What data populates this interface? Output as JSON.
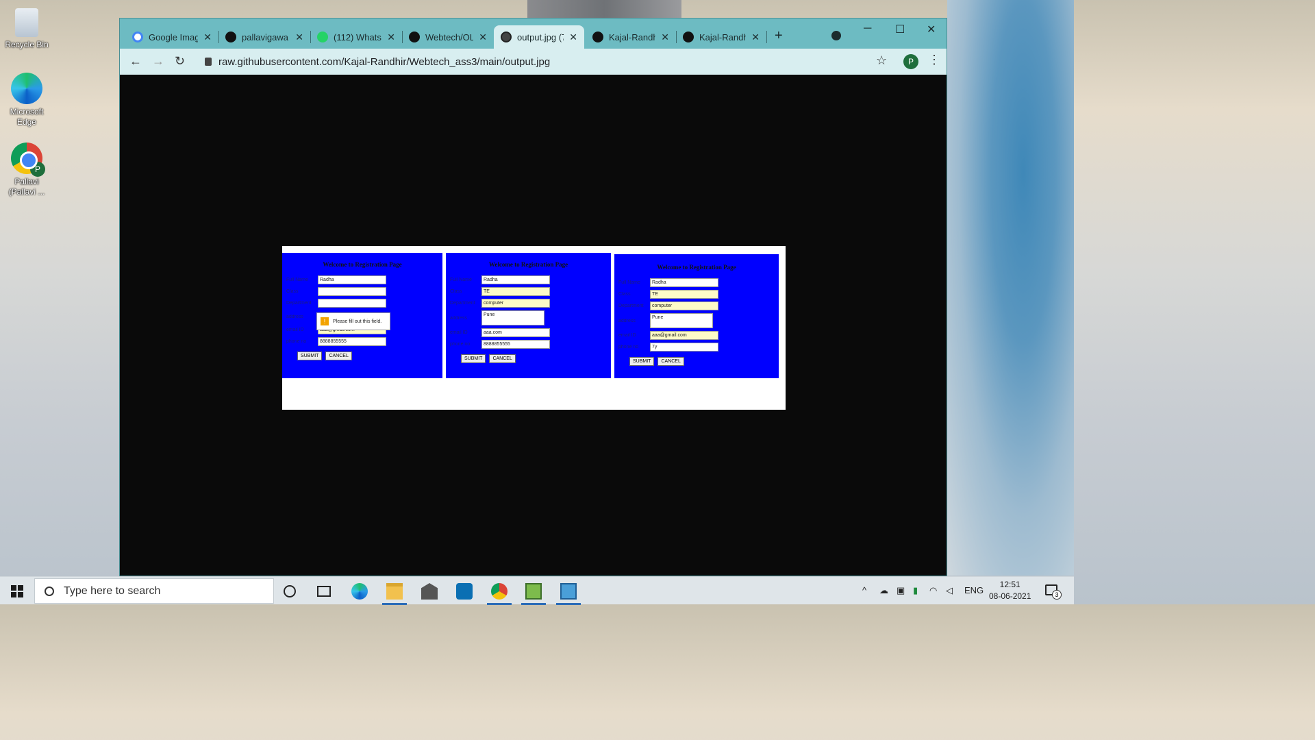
{
  "desktop": {
    "icons": [
      {
        "label": "Recycle Bin"
      },
      {
        "label": "Microsoft Edge"
      },
      {
        "label": "Pallavi (Pallavi ...",
        "badge": "P"
      }
    ]
  },
  "browser": {
    "tabs": [
      {
        "title": "Google Imag",
        "icon": "google-icon"
      },
      {
        "title": "pallavigawa",
        "icon": "github-icon"
      },
      {
        "title": "(112) Whats",
        "icon": "whatsapp-icon"
      },
      {
        "title": "Webtech/OL",
        "icon": "github-icon"
      },
      {
        "title": "output.jpg (7",
        "icon": "globe-icon",
        "active": true
      },
      {
        "title": "Kajal-Randhi",
        "icon": "github-icon"
      },
      {
        "title": "Kajal-Randh",
        "icon": "github-icon"
      }
    ],
    "new_tab": "+",
    "url": "raw.githubusercontent.com/Kajal-Randhir/Webtech_ass3/main/output.jpg",
    "profile_initial": "P",
    "window_controls": {
      "minimize": "─",
      "maximize": "☐",
      "close": "✕"
    }
  },
  "image": {
    "panels": [
      {
        "title": "Welcome to Registration Page",
        "fields": [
          {
            "label": "Full Name",
            "value": "Radha",
            "highlight": false
          },
          {
            "label": "Class",
            "value": "",
            "highlight": false
          },
          {
            "label": "Department",
            "value": "",
            "highlight": false
          },
          {
            "label": "address",
            "value": "",
            "highlight": false
          },
          {
            "label": "email ID",
            "value": "aaa@gmail.com",
            "highlight": true
          },
          {
            "label": "phone no",
            "value": "8888855555",
            "highlight": false
          }
        ],
        "tooltip": "Please fill out this field.",
        "submit": "SUBMIT",
        "cancel": "CANCEL"
      },
      {
        "title": "Welcome to Registration Page",
        "fields": [
          {
            "label": "Full Name",
            "value": "Radha",
            "highlight": false
          },
          {
            "label": "Class",
            "value": "TE",
            "highlight": true
          },
          {
            "label": "Department",
            "value": "computer",
            "highlight": true
          },
          {
            "label": "address",
            "value": "Pune",
            "highlight": false
          },
          {
            "label": "email ID",
            "value": "aaa.com",
            "highlight": false
          },
          {
            "label": "phone no",
            "value": "8888855555",
            "highlight": false
          }
        ],
        "submit": "SUBMIT",
        "cancel": "CANCEL"
      },
      {
        "title": "Welcome to Registration Page",
        "fields": [
          {
            "label": "Full Name",
            "value": "Radha",
            "highlight": false
          },
          {
            "label": "Class",
            "value": "TE",
            "highlight": true
          },
          {
            "label": "Department",
            "value": "computer",
            "highlight": true
          },
          {
            "label": "address",
            "value": "Pune",
            "highlight": false
          },
          {
            "label": "email ID",
            "value": "aaa@gmail.com",
            "highlight": true
          },
          {
            "label": "phone no",
            "value": "7y",
            "highlight": false
          }
        ],
        "submit": "SUBMIT",
        "cancel": "CANCEL"
      }
    ]
  },
  "taskbar": {
    "search_placeholder": "Type here to search",
    "language": "ENG",
    "time": "12:51",
    "date": "08-06-2021",
    "notification_count": "3"
  }
}
